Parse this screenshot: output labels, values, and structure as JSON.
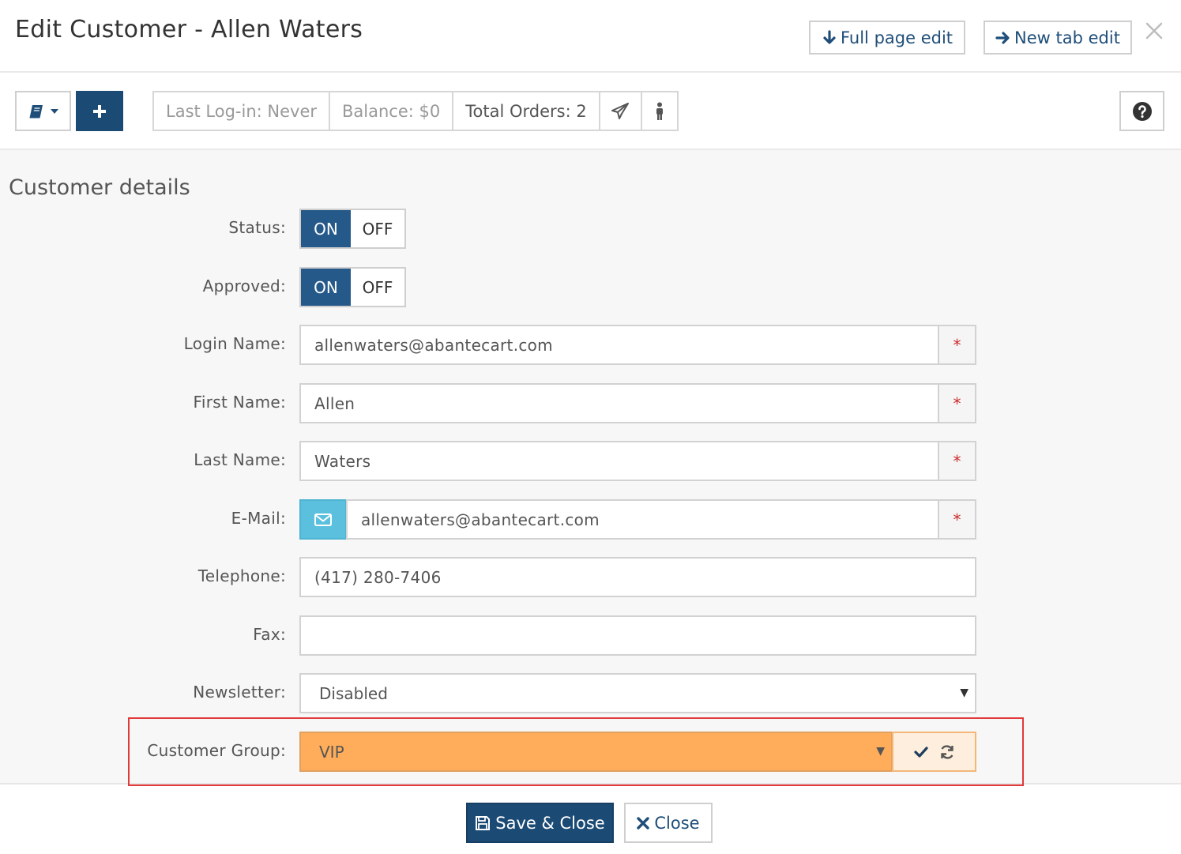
{
  "header": {
    "title": "Edit Customer - Allen Waters",
    "full_page_edit_label": "Full page edit",
    "new_tab_edit_label": "New tab edit",
    "close_icon": "close-icon"
  },
  "toolbar": {
    "book_menu_icon": "book-icon",
    "add_icon": "plus-icon",
    "last_login": "Last Log-in: Never",
    "balance": "Balance: $0",
    "total_orders": "Total Orders: 2",
    "send_icon": "paper-plane-icon",
    "login_as_icon": "male-icon",
    "help_icon": "question-circle-icon"
  },
  "section": {
    "title": "Customer details"
  },
  "form": {
    "status": {
      "label": "Status:",
      "on_label": "ON",
      "off_label": "OFF",
      "value": "ON"
    },
    "approved": {
      "label": "Approved:",
      "on_label": "ON",
      "off_label": "OFF",
      "value": "ON"
    },
    "login_name": {
      "label": "Login Name:",
      "value": "allenwaters@abantecart.com",
      "required_mark": "*"
    },
    "first_name": {
      "label": "First Name:",
      "value": "Allen",
      "required_mark": "*"
    },
    "last_name": {
      "label": "Last Name:",
      "value": "Waters",
      "required_mark": "*"
    },
    "email": {
      "label": "E-Mail:",
      "value": "allenwaters@abantecart.com",
      "required_mark": "*",
      "icon": "envelope-icon"
    },
    "telephone": {
      "label": "Telephone:",
      "value": "(417) 280-7406"
    },
    "fax": {
      "label": "Fax:",
      "value": ""
    },
    "newsletter": {
      "label": "Newsletter:",
      "value": "Disabled"
    },
    "customer_group": {
      "label": "Customer Group:",
      "value": "VIP"
    }
  },
  "footer": {
    "save_close_label": "Save & Close",
    "close_label": "Close"
  },
  "colors": {
    "primary": "#1b4a74",
    "toggle_on": "#25598a",
    "email_addon": "#5bc0de",
    "changed_field": "#ffad5a",
    "highlight_border": "#e03a3a",
    "required": "#cc2a2a"
  }
}
